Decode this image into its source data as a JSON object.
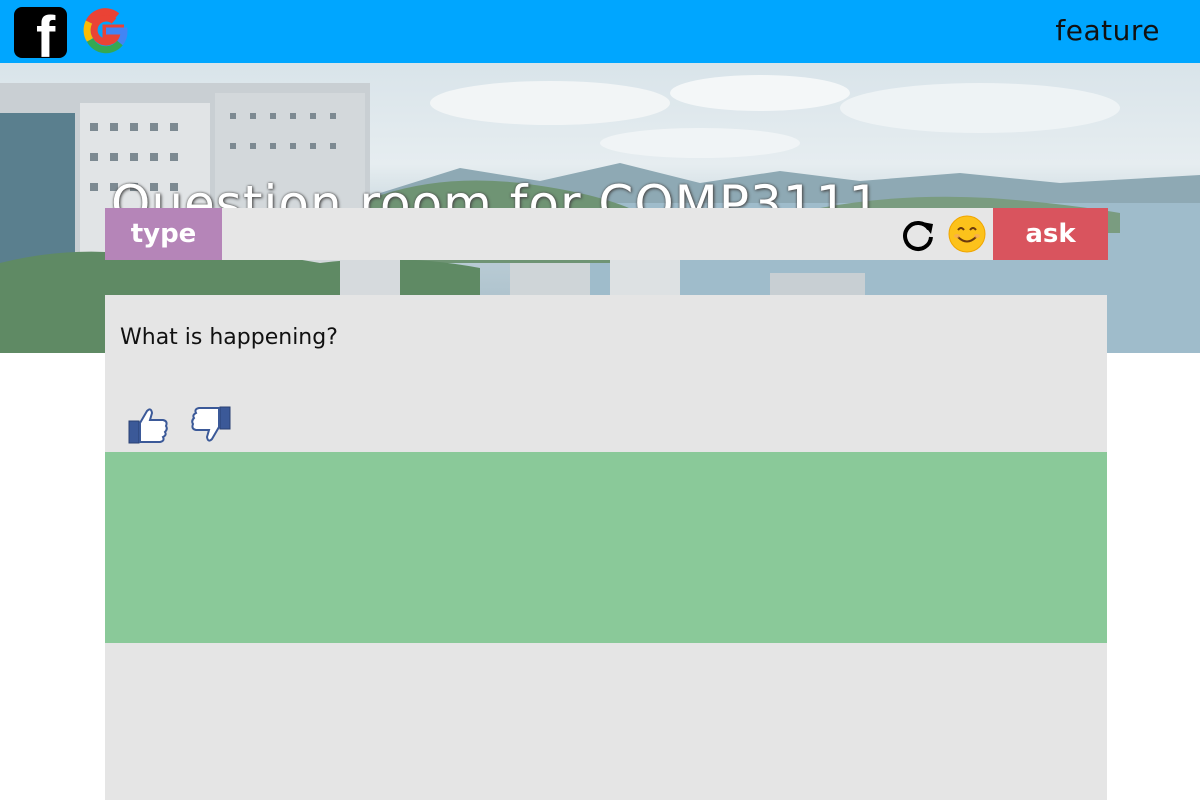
{
  "header": {
    "facebook_icon": "facebook-icon",
    "google_icon": "google-icon",
    "feature_label": "feature",
    "colors": {
      "bar": "#00a6ff"
    }
  },
  "banner": {
    "title": "Question room for COMP3111"
  },
  "ask_bar": {
    "type_label": "type",
    "input_value": "",
    "refresh_icon": "refresh-icon",
    "emoji_icon": "smiley-emoji-icon",
    "ask_label": "ask",
    "colors": {
      "type": "#b585b8",
      "ask": "#d9545e"
    }
  },
  "question": {
    "text": "What is happening?",
    "like_icon": "thumbs-up-icon",
    "dislike_icon": "thumbs-down-icon"
  },
  "panels": {
    "answer_color": "#8ac999",
    "card_color": "#e5e5e5"
  }
}
